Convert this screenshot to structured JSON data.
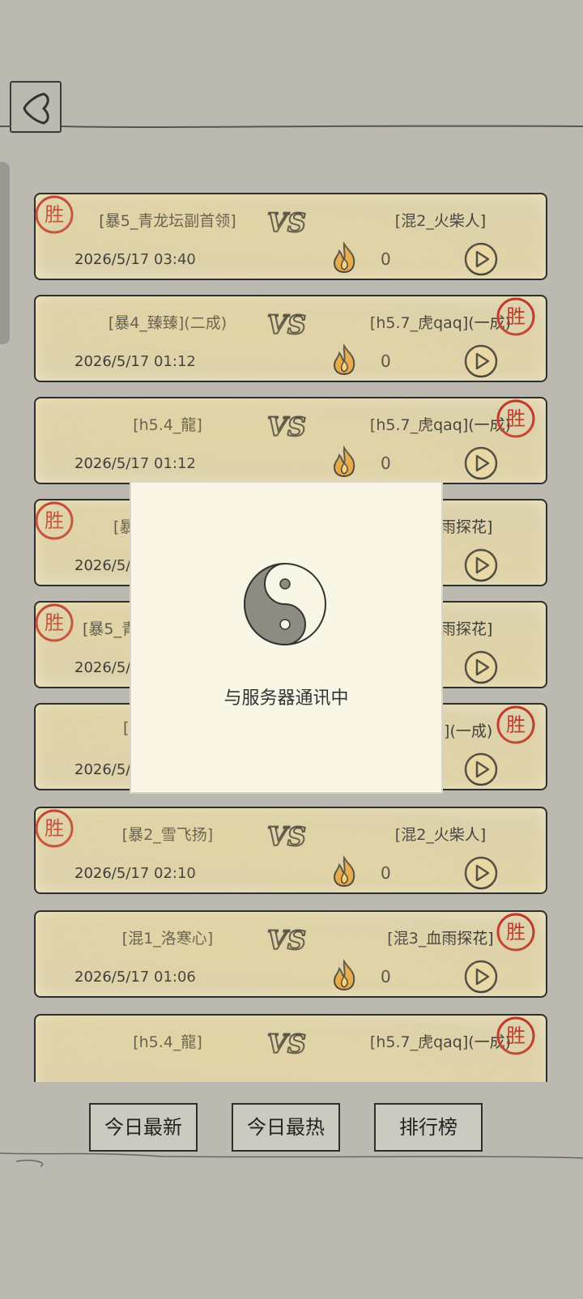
{
  "header": {
    "back_label": "<"
  },
  "matches": [
    {
      "left_player": "[暴5_青龙坛副首领]",
      "right_player": "[混2_火柴人]",
      "date": "2026/5/17 03:40",
      "score": "0",
      "winner": "left"
    },
    {
      "left_player": "[暴4_臻臻](二成)",
      "right_player": "[h5.7_虎qaq](一成)",
      "date": "2026/5/17 01:12",
      "score": "0",
      "winner": "right"
    },
    {
      "left_player": "[h5.4_龍]",
      "right_player": "[h5.7_虎qaq](一成)",
      "date": "2026/5/17 01:12",
      "score": "0",
      "winner": "right"
    },
    {
      "left_player": "[暴",
      "right_player": "雨探花]",
      "date": "2026/5/",
      "score": "",
      "winner": "left"
    },
    {
      "left_player": "[暴5_青",
      "right_player": "雨探花]",
      "date": "2026/5/",
      "score": "",
      "winner": "left"
    },
    {
      "left_player": "[",
      "right_player": "q](一成)",
      "date": "2026/5/",
      "score": "",
      "winner": "right"
    },
    {
      "left_player": "[暴2_雪飞扬]",
      "right_player": "[混2_火柴人]",
      "date": "2026/5/17 02:10",
      "score": "0",
      "winner": "left"
    },
    {
      "left_player": "[混1_洛寒心]",
      "right_player": "[混3_血雨探花]",
      "date": "2026/5/17 01:06",
      "score": "0",
      "winner": "right"
    },
    {
      "left_player": "[h5.4_龍]",
      "right_player": "[h5.7_虎qaq](一成)",
      "date": "",
      "score": "",
      "winner": "right"
    }
  ],
  "vs_label": "VS",
  "seal_label": "胜",
  "modal": {
    "message": "与服务器通讯中"
  },
  "bottom_tabs": [
    {
      "label": "今日最新"
    },
    {
      "label": "今日最热"
    },
    {
      "label": "排行榜"
    }
  ],
  "colors": {
    "background": "#bcbab0",
    "card": "#ddd2ad",
    "seal": "#c0392b",
    "modal": "#faf6e6"
  }
}
